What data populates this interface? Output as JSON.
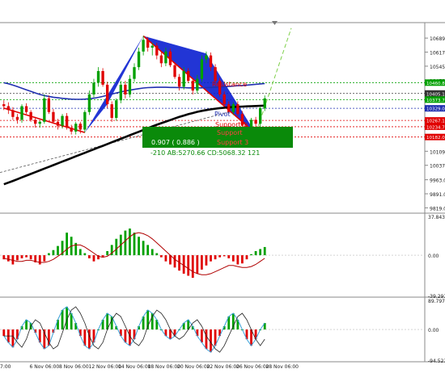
{
  "colors": {
    "up": "#00a000",
    "down": "#e00000",
    "macd_line": "#b00000",
    "blue_ma": "#1f2fb0",
    "black_ma": "#000000",
    "pattern_fill": "#0a1fd0",
    "green_box": "#0a8a0a",
    "grid": "#c8c8c8",
    "axis_text": "#222222",
    "osc_blue": "#3aa0d8"
  },
  "price_axis": {
    "ylim": [
      9800,
      10760
    ],
    "ticks": [
      "10689.0",
      "10617.0",
      "10545.0",
      "10473.0",
      "10401.0",
      "10329.0",
      "10257.0",
      "10185.0",
      "10109.0",
      "10037.0",
      "9963.0",
      "9891.0",
      "9819.0"
    ],
    "tags": [
      {
        "text": "10460.8",
        "value": 10460.8,
        "color": "#00a000"
      },
      {
        "text": "10405.1",
        "value": 10405.1,
        "color": "#333333"
      },
      {
        "text": "10373.7",
        "value": 10373.7,
        "color": "#00a000"
      },
      {
        "text": "10329.0",
        "value": 10329.0,
        "color": "#1f2fb0"
      },
      {
        "text": "10267.1",
        "value": 10267.1,
        "color": "#e00000"
      },
      {
        "text": "10234.7",
        "value": 10234.7,
        "color": "#e00000"
      },
      {
        "text": "10182.0",
        "value": 10182.0,
        "color": "#e00000"
      }
    ]
  },
  "labels": {
    "resistance": "Resistance",
    "pivot": "Pivot",
    "support": "Support 1",
    "support2": "Support",
    "support3": "Support 3",
    "ratio": "0.907 ( 0.886 )",
    "pattern_info": "-210   AB:5270.66 CD:5068.32   121"
  },
  "macd_axis": {
    "ylim": [
      -39.291,
      37.843
    ],
    "ticks": [
      "37.843",
      "0.00",
      "-39.291"
    ]
  },
  "osc_axis": {
    "ylim": [
      -94.521,
      89.797
    ],
    "ticks": [
      "89.797",
      "0.00",
      "-94.521"
    ]
  },
  "time_axis": [
    "7:00",
    "6 Nov 06:00",
    "8 Nov 06:00",
    "12 Nov 06:00",
    "14 Nov 06:00",
    "18 Nov 06:00",
    "20 Nov 06:00",
    "22 Nov 06:00",
    "26 Nov 06:00",
    "28 Nov 06:00"
  ],
  "chart_data": [
    {
      "type": "candlestick",
      "panel": "price",
      "ylim": [
        9800,
        10760
      ],
      "candles": [
        [
          10350,
          10370,
          10320,
          10340
        ],
        [
          10340,
          10360,
          10300,
          10320
        ],
        [
          10320,
          10335,
          10270,
          10285
        ],
        [
          10285,
          10300,
          10250,
          10270
        ],
        [
          10270,
          10350,
          10255,
          10340
        ],
        [
          10340,
          10355,
          10300,
          10310
        ],
        [
          10310,
          10320,
          10260,
          10270
        ],
        [
          10270,
          10285,
          10230,
          10250
        ],
        [
          10250,
          10265,
          10230,
          10260
        ],
        [
          10260,
          10400,
          10250,
          10380
        ],
        [
          10380,
          10395,
          10300,
          10310
        ],
        [
          10310,
          10325,
          10250,
          10260
        ],
        [
          10260,
          10275,
          10220,
          10240
        ],
        [
          10240,
          10300,
          10225,
          10290
        ],
        [
          10290,
          10305,
          10220,
          10230
        ],
        [
          10230,
          10245,
          10195,
          10210
        ],
        [
          10210,
          10260,
          10195,
          10250
        ],
        [
          10250,
          10260,
          10200,
          10220
        ],
        [
          10220,
          10320,
          10205,
          10310
        ],
        [
          10310,
          10420,
          10295,
          10400
        ],
        [
          10400,
          10480,
          10385,
          10460
        ],
        [
          10460,
          10540,
          10440,
          10520
        ],
        [
          10520,
          10535,
          10440,
          10450
        ],
        [
          10450,
          10465,
          10330,
          10350
        ],
        [
          10350,
          10365,
          10260,
          10280
        ],
        [
          10280,
          10380,
          10265,
          10370
        ],
        [
          10370,
          10470,
          10355,
          10450
        ],
        [
          10450,
          10470,
          10380,
          10400
        ],
        [
          10400,
          10500,
          10385,
          10480
        ],
        [
          10480,
          10560,
          10465,
          10540
        ],
        [
          10540,
          10640,
          10525,
          10620
        ],
        [
          10620,
          10700,
          10600,
          10680
        ],
        [
          10680,
          10695,
          10620,
          10640
        ],
        [
          10640,
          10665,
          10600,
          10650
        ],
        [
          10650,
          10665,
          10580,
          10600
        ],
        [
          10600,
          10615,
          10540,
          10560
        ],
        [
          10560,
          10640,
          10545,
          10620
        ],
        [
          10620,
          10635,
          10540,
          10550
        ],
        [
          10550,
          10565,
          10480,
          10490
        ],
        [
          10490,
          10505,
          10420,
          10440
        ],
        [
          10440,
          10540,
          10425,
          10520
        ],
        [
          10520,
          10535,
          10460,
          10470
        ],
        [
          10470,
          10485,
          10400,
          10420
        ],
        [
          10420,
          10500,
          10405,
          10480
        ],
        [
          10480,
          10600,
          10465,
          10580
        ],
        [
          10580,
          10620,
          10560,
          10600
        ],
        [
          10600,
          10615,
          10520,
          10540
        ],
        [
          10540,
          10555,
          10460,
          10470
        ],
        [
          10470,
          10485,
          10390,
          10400
        ],
        [
          10400,
          10415,
          10340,
          10350
        ],
        [
          10350,
          10365,
          10300,
          10310
        ],
        [
          10310,
          10360,
          10295,
          10350
        ],
        [
          10350,
          10365,
          10290,
          10300
        ],
        [
          10300,
          10315,
          10230,
          10240
        ],
        [
          10240,
          10255,
          10200,
          10210
        ],
        [
          10210,
          10280,
          10195,
          10270
        ],
        [
          10270,
          10285,
          10230,
          10250
        ],
        [
          10250,
          10340,
          10235,
          10330
        ],
        [
          10330,
          10395,
          10315,
          10380
        ]
      ]
    },
    {
      "type": "line",
      "panel": "price",
      "name": "blue_ma",
      "values": [
        10460,
        10455,
        10448,
        10440,
        10432,
        10424,
        10416,
        10408,
        10400,
        10394,
        10390,
        10386,
        10383,
        10380,
        10378,
        10376,
        10375,
        10375,
        10376,
        10378,
        10381,
        10385,
        10390,
        10396,
        10402,
        10408,
        10413,
        10418,
        10422,
        10426,
        10430,
        10433,
        10435,
        10436,
        10437,
        10437,
        10437,
        10436,
        10436,
        10435,
        10435,
        10434,
        10434,
        10434,
        10434,
        10435,
        10436,
        10437,
        10438,
        10440,
        10441,
        10443,
        10445,
        10446,
        10448,
        10450,
        10452,
        10454,
        10456
      ]
    },
    {
      "type": "line",
      "panel": "price",
      "name": "black_ma",
      "values": [
        9940,
        9948,
        9957,
        9966,
        9975,
        9984,
        9993,
        10002,
        10011,
        10020,
        10029,
        10038,
        10047,
        10056,
        10065,
        10074,
        10083,
        10092,
        10101,
        10110,
        10119,
        10128,
        10137,
        10146,
        10155,
        10164,
        10173,
        10182,
        10191,
        10200,
        10209,
        10218,
        10227,
        10236,
        10245,
        10253,
        10261,
        10269,
        10277,
        10285,
        10292,
        10299,
        10305,
        10311,
        10316,
        10320,
        10324,
        10327,
        10330,
        10332,
        10334,
        10336,
        10337,
        10338,
        10339,
        10340,
        10341,
        10342,
        10343
      ]
    },
    {
      "type": "bar",
      "panel": "macd",
      "ylim": [
        -39.291,
        37.843
      ],
      "values": [
        -4,
        -6,
        -9,
        -5,
        -3,
        -2,
        -4,
        -7,
        -9,
        -6,
        2,
        5,
        9,
        14,
        22,
        18,
        12,
        6,
        2,
        -3,
        -6,
        -4,
        -2,
        4,
        10,
        16,
        20,
        24,
        26,
        22,
        18,
        14,
        10,
        6,
        2,
        -2,
        -6,
        -9,
        -12,
        -15,
        -18,
        -20,
        -22,
        -18,
        -14,
        -10,
        -6,
        -4,
        -2,
        -1,
        -3,
        -6,
        -9,
        -8,
        -4,
        1,
        4,
        6,
        8
      ]
    },
    {
      "type": "line",
      "panel": "macd",
      "name": "signal",
      "values": [
        -3,
        -4,
        -5,
        -6,
        -6,
        -5,
        -5,
        -6,
        -7,
        -7,
        -6,
        -4,
        -1,
        2,
        6,
        9,
        10,
        10,
        8,
        5,
        2,
        -1,
        -2,
        -1,
        2,
        6,
        10,
        14,
        18,
        21,
        22,
        21,
        19,
        16,
        12,
        8,
        4,
        0,
        -4,
        -7,
        -10,
        -13,
        -16,
        -18,
        -19,
        -19,
        -18,
        -16,
        -14,
        -12,
        -10,
        -10,
        -11,
        -12,
        -12,
        -11,
        -9,
        -6,
        -3
      ]
    },
    {
      "type": "bar",
      "panel": "oscillator",
      "ylim": [
        -94.521,
        89.797
      ],
      "values": [
        -20,
        -40,
        -55,
        -30,
        10,
        30,
        20,
        -10,
        -40,
        -60,
        -50,
        -10,
        30,
        60,
        70,
        50,
        20,
        -20,
        -50,
        -60,
        -40,
        0,
        30,
        50,
        40,
        10,
        -20,
        -40,
        -50,
        -30,
        10,
        40,
        60,
        50,
        30,
        0,
        -20,
        -30,
        -20,
        0,
        20,
        30,
        10,
        -20,
        -40,
        -60,
        -70,
        -50,
        -20,
        10,
        40,
        50,
        30,
        0,
        -30,
        -50,
        -30,
        0,
        20
      ]
    }
  ]
}
